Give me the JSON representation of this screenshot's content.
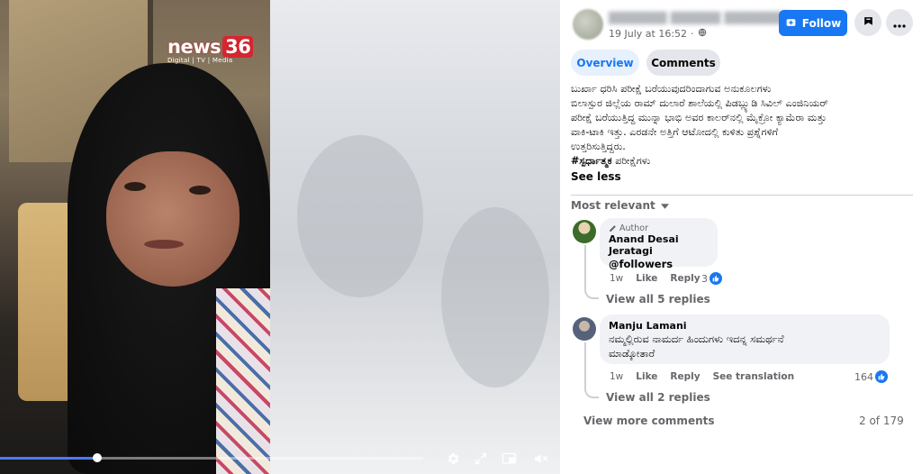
{
  "video": {
    "brand": {
      "main": "news",
      "number": "36",
      "sub": "Digital | TV | Media"
    },
    "progress_fraction": 0.23
  },
  "post": {
    "date": "19 July at 16:52",
    "follow_label": "Follow",
    "tabs": [
      "Overview",
      "Comments"
    ],
    "text_lines": [
      "ಬುರ್ಖಾ ಧರಿಸಿ ಪರೀಕ್ಷೆ ಬರೆಯುವುದರಿಂದಾಗುವ ಅನುಕೂಲಗಳು",
      "ಬಿಲಾಸ್ಪುರ ಜಿಲ್ಲೆಯ ರಾಮ್ ದುಲಾರೆ ಶಾಲೆಯಲ್ಲಿ ಪಿಡಬ್ಲ್ಯುಡಿ ಸಿವಿಲ್ ಎಂಜಿನಿಯರ್",
      "ಪರೀಕ್ಷೆ ಬರೆಯುತ್ತಿದ್ದ ಮುನ್ನಾ ಭಾಭಿ ಅವರ ಕಾಲರ್‌ನಲ್ಲಿ ಮೈಕ್ರೋ ಕ್ಯಾಮೆರಾ ಮತ್ತು",
      "ವಾಕಿ-ಟಾಕಿ ಇತ್ತು. ಎರಡನೇ ಅತ್ತಿಗೆ ಆಟೋದಲ್ಲಿ ಕುಳಿತು ಪ್ರಶ್ನೆಗಳಿಗೆ",
      "ಉತ್ತರಿಸುತ್ತಿದ್ದರು."
    ],
    "hashtag": "#ಸ್ಪರ್ಧಾತ್ಮಕ",
    "hashtag_rest": " ಪರೀಕ್ಷೆಗಳು",
    "see_less": "See less"
  },
  "comments_section": {
    "sort_label": "Most relevant",
    "comments": [
      {
        "badge": "Author",
        "name": "Anand Desai Jeratagi",
        "text": "@followers",
        "time": "1w",
        "like": "Like",
        "reply": "Reply",
        "reactions": "3",
        "view_replies": "View all 5 replies"
      },
      {
        "name": "Manju Lamani",
        "text_lines": [
          "ನಮ್ಮಲ್ಲಿರುವ ನಾಮರ್ದ ಹಿಂದುಗಳು ಇದನ್ನ ಸಮರ್ಥನೆ",
          "ಮಾಡ್ಕೋತಾರೆ"
        ],
        "time": "1w",
        "like": "Like",
        "reply": "Reply",
        "see_translation": "See translation",
        "reactions": "164",
        "view_replies": "View all 2 replies"
      }
    ],
    "view_more": "View more comments",
    "count": "2 of 179"
  },
  "colors": {
    "accent": "#1877f2",
    "muted": "#65676b",
    "bubble": "#f0f2f5"
  }
}
